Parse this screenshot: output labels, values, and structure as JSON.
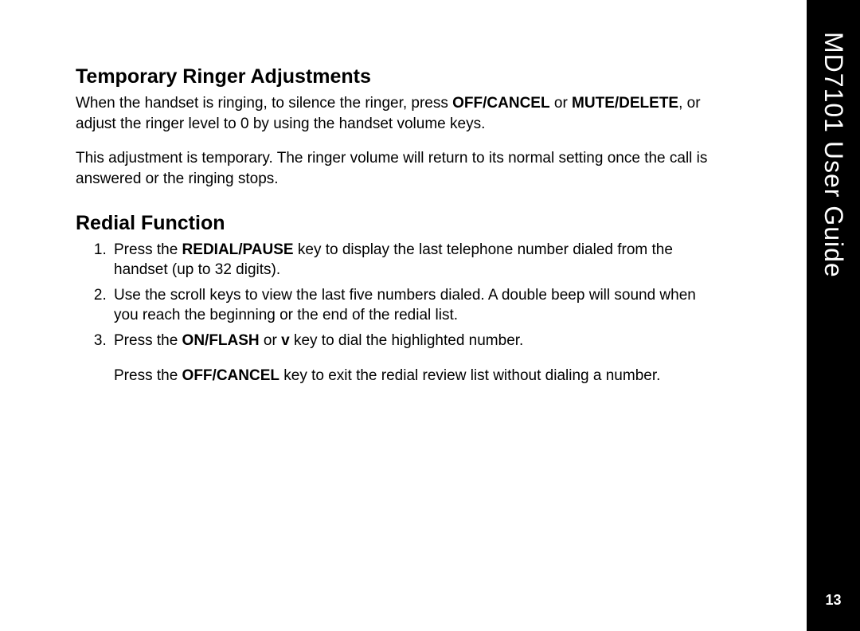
{
  "sideTab": {
    "title": "MD7101 User Guide",
    "pageNumber": "13"
  },
  "section1": {
    "heading": "Temporary Ringer Adjustments",
    "p1_a": "When the handset is ringing, to silence the ringer, press ",
    "p1_key1": "OFF/CANCEL",
    "p1_b": " or ",
    "p1_key2": "MUTE/DELETE",
    "p1_c": ", or adjust the ringer level to 0 by using the handset volume keys.",
    "p2": "This adjustment is temporary. The ringer volume will return to its normal setting once the call is answered or the ringing stops."
  },
  "section2": {
    "heading": "Redial Function",
    "li1_a": "Press the ",
    "li1_key": "REDIAL/PAUSE",
    "li1_b": " key to display the last telephone number dialed from the handset (up to 32 digits).",
    "li2": "Use the scroll keys to view the last five numbers dialed. A double beep will sound when you reach the beginning or the end of the redial list.",
    "li3_a": "Press the ",
    "li3_key1": "ON/FLASH",
    "li3_b": " or ",
    "li3_key2": "v",
    "li3_c": "    key to dial the highlighted number.",
    "li3_p2_a": "Press the ",
    "li3_p2_key": "OFF/CANCEL",
    "li3_p2_b": " key to exit the redial review list without dialing a number."
  }
}
